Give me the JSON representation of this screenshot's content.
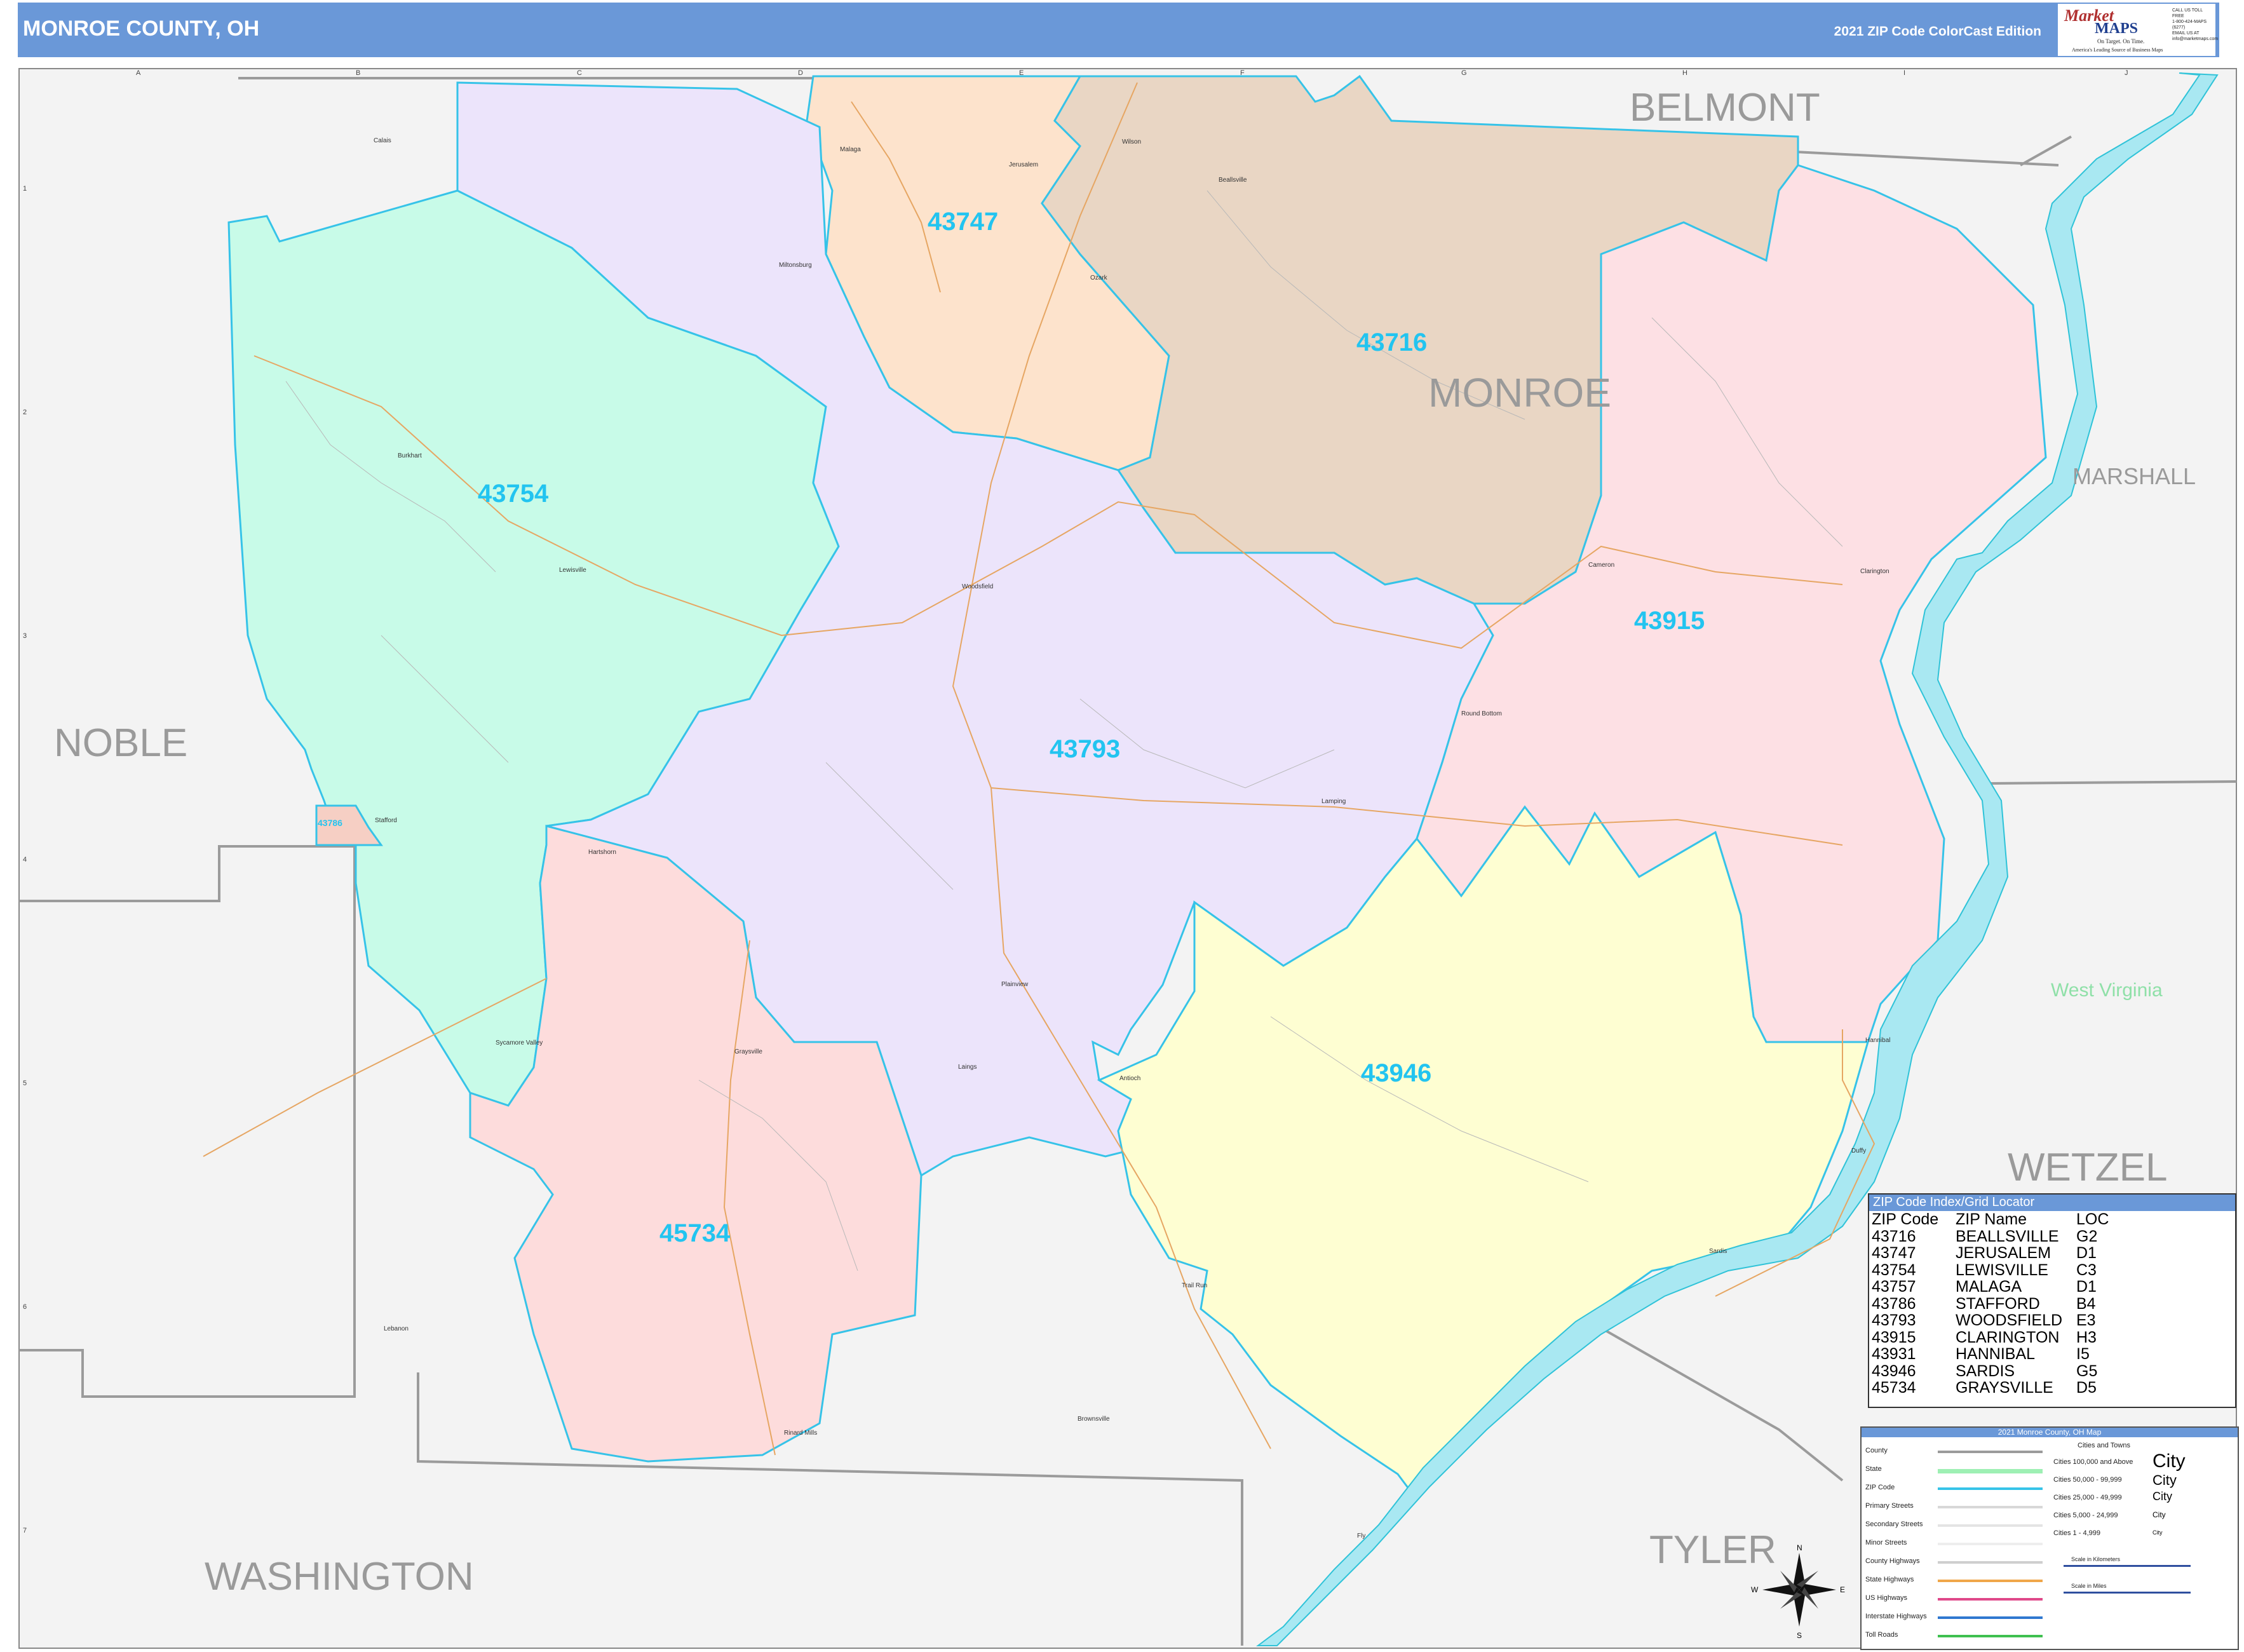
{
  "header": {
    "title": "MONROE COUNTY, OH",
    "edition": "2021 ZIP Code ColorCast Edition",
    "logo": {
      "brand_top": "Market",
      "brand_bottom": "MAPS",
      "tagline": "On Target. On Time.",
      "slogan": "America's Leading Source of Business Maps",
      "phone_lines": [
        "CALL US TOLL FREE",
        "1-800-424-MAPS (6277)",
        "EMAIL US AT",
        "info@marketmaps.com"
      ]
    }
  },
  "map": {
    "county_labels": [
      "BELMONT",
      "MONROE",
      "NOBLE",
      "WASHINGTON",
      "TYLER",
      "WETZEL",
      "MARSHALL"
    ],
    "state_label": "West Virginia",
    "zip_labels": [
      "43747",
      "43716",
      "43754",
      "43915",
      "43793",
      "43946",
      "45734",
      "43786"
    ],
    "towns": [
      "Malaga",
      "Jerusalem",
      "Wilson",
      "Beallsville",
      "Ozark",
      "Miltonsburg",
      "Burkhart",
      "Lewisville",
      "Woodsfield",
      "Cameron",
      "Clarington",
      "Round Bottom",
      "Lamping",
      "Stafford",
      "Hartshorn",
      "Plainview",
      "Antioch",
      "Graysville",
      "Sycamore Valley",
      "Rinard Mills",
      "Brownsville",
      "Trail Run",
      "Lebanon",
      "Sardis",
      "Hannibal",
      "Duffy",
      "Fly",
      "Calais",
      "Laings"
    ],
    "grid_columns": [
      "A",
      "B",
      "C",
      "D",
      "E",
      "F",
      "G",
      "H",
      "I",
      "J"
    ],
    "grid_rows": [
      "1",
      "2",
      "3",
      "4",
      "5",
      "6",
      "7"
    ],
    "colors": {
      "z43747": "#fde3cc",
      "z43716": "#e9d6c4",
      "z43754": "#c8fbe8",
      "z43915": "#fde0e4",
      "z43793": "#ece4fb",
      "z43946": "#fefed2",
      "z45734": "#fddcdc",
      "z43786": "#f6cfc4",
      "zip_border": "#36c3e8",
      "river": "#a9e8f2",
      "river_edge": "#2fc3d8",
      "outside": "#f3f3f3",
      "county_line": "#9b9b9b",
      "road": "#e6a663",
      "header": "#6a98d8"
    }
  },
  "zip_index": {
    "title": "ZIP Code Index/Grid Locator",
    "columns": [
      "ZIP Code",
      "ZIP Name",
      "LOC"
    ],
    "rows": [
      [
        "43716",
        "BEALLSVILLE",
        "G2"
      ],
      [
        "43747",
        "JERUSALEM",
        "D1"
      ],
      [
        "43754",
        "LEWISVILLE",
        "C3"
      ],
      [
        "43757",
        "MALAGA",
        "D1"
      ],
      [
        "43786",
        "STAFFORD",
        "B4"
      ],
      [
        "43793",
        "WOODSFIELD",
        "E3"
      ],
      [
        "43915",
        "CLARINGTON",
        "H3"
      ],
      [
        "43931",
        "HANNIBAL",
        "I5"
      ],
      [
        "43946",
        "SARDIS",
        "G5"
      ],
      [
        "45734",
        "GRAYSVILLE",
        "D5"
      ]
    ]
  },
  "legend": {
    "title": "2021 Monroe County, OH Map",
    "items": [
      {
        "label": "County",
        "color": "#9b9b9b"
      },
      {
        "label": "State",
        "color": "#9ef0b4"
      },
      {
        "label": "ZIP Code",
        "color": "#36c3e8"
      },
      {
        "label": "Primary Streets",
        "color": "#d8d8d8"
      },
      {
        "label": "Secondary Streets",
        "color": "#e4e4e4"
      },
      {
        "label": "Minor Streets",
        "color": "#eeeeee"
      },
      {
        "label": "County Highways",
        "color": "#cfcfcf"
      },
      {
        "label": "State Highways",
        "color": "#f0a64a"
      },
      {
        "label": "US Highways",
        "color": "#e0488a"
      },
      {
        "label": "Interstate Highways",
        "color": "#2f78d0"
      },
      {
        "label": "Toll Roads",
        "color": "#3fc050"
      }
    ],
    "city_header": "Cities and Towns",
    "cities": [
      {
        "range": "Cities 100,000 and Above",
        "sample": "City"
      },
      {
        "range": "Cities 50,000 - 99,999",
        "sample": "City"
      },
      {
        "range": "Cities 25,000 - 49,999",
        "sample": "City"
      },
      {
        "range": "Cities 5,000 - 24,999",
        "sample": "City"
      },
      {
        "range": "Cities 1 - 4,999",
        "sample": "City"
      }
    ],
    "scale_km": "Scale in Kilometers",
    "scale_mi": "Scale in Miles"
  }
}
